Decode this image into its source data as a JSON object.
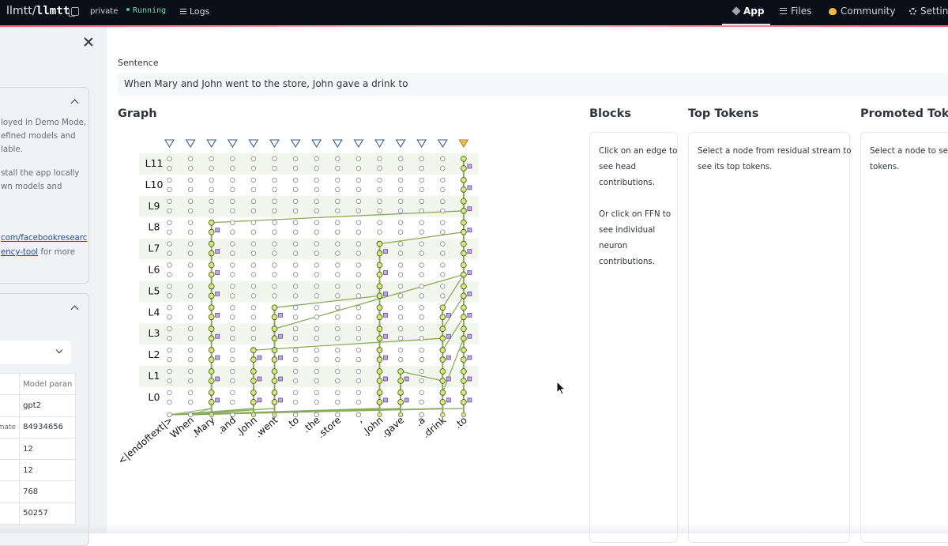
{
  "topbar": {
    "owner": "llmtt/",
    "repo": "llmtt",
    "visibility": "private",
    "status": "Running",
    "logs": "Logs",
    "nav": [
      {
        "label": "App",
        "icon": "app-icon",
        "active": true
      },
      {
        "label": "Files",
        "icon": "files-icon",
        "active": false
      },
      {
        "label": "Community",
        "icon": "community-icon",
        "active": false
      },
      {
        "label": "Settin",
        "icon": "gear-icon",
        "active": false
      }
    ]
  },
  "sidebar": {
    "panel1": {
      "text1": "loyed in Demo Mode,\nefined models and\nlable.",
      "text2": "stall the app locally\nwn models and",
      "link1": "com/facebookresearc",
      "link2": "ency-tool",
      "more": " for more"
    },
    "table": {
      "header": "Model paran",
      "rows": [
        {
          "key": "",
          "value": "gpt2"
        },
        {
          "key": "stimate",
          "value": "84934656"
        },
        {
          "key": "",
          "value": "12"
        },
        {
          "key": "",
          "value": "12"
        },
        {
          "key": "",
          "value": "768"
        },
        {
          "key": "",
          "value": "50257"
        }
      ]
    }
  },
  "main": {
    "sentence_label": "Sentence",
    "sentence_value": "When Mary and John went to the store, John gave a drink to",
    "graph_title": "Graph",
    "blocks": {
      "title": "Blocks",
      "text": "Click on an edge to\nsee head\ncontributions.\n\nOr click on FFN to\nsee individual\nneuron\ncontributions."
    },
    "top_tokens": {
      "title": "Top Tokens",
      "text": "Select a node from residual stream to\nsee its top tokens."
    },
    "promoted": {
      "title": "Promoted Token",
      "text": "Select a node to see it\ntokens."
    }
  },
  "graph": {
    "layers": [
      "L11",
      "L10",
      "L9",
      "L8",
      "L7",
      "L6",
      "L5",
      "L4",
      "L3",
      "L2",
      "L1",
      "L0"
    ],
    "tokens": [
      "<|endoftext|>",
      "When",
      ".Mary",
      ".and",
      ".John",
      ".went",
      ".to",
      ".the",
      ".store",
      ",",
      ".John",
      ".gave",
      ".a",
      ".drink",
      ".to"
    ],
    "selected_token": 14,
    "colors": {
      "edge": "#8aab5c",
      "active_node": "#d4ea7a",
      "ffn": "#c4a6e8",
      "triangle": "#7fb1e0",
      "triangle_selected": "#f6b94a",
      "band": "#f3f6ec"
    }
  }
}
